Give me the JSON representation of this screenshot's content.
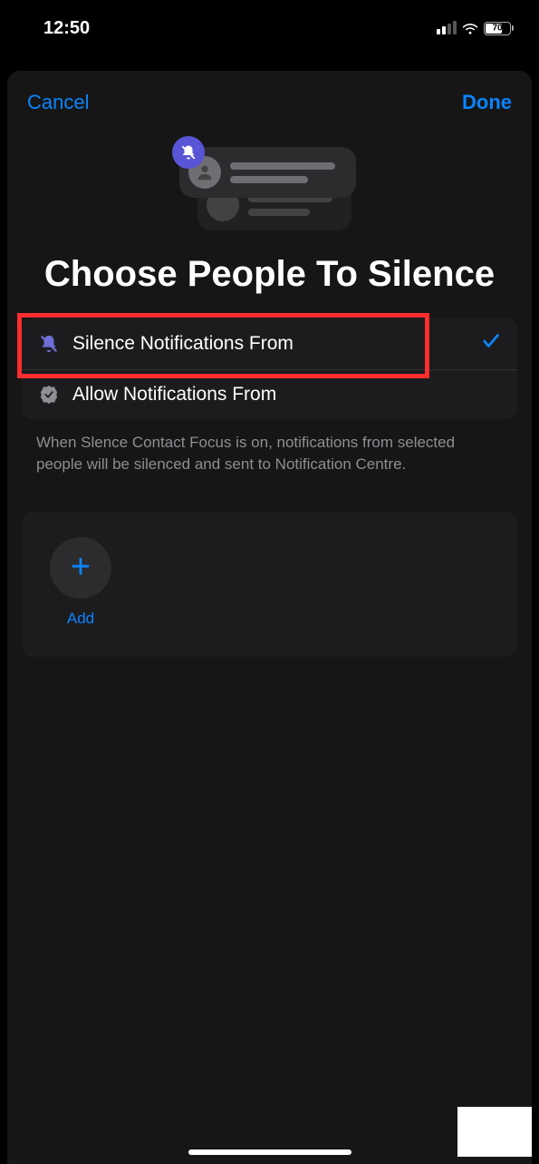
{
  "statusBar": {
    "time": "12:50",
    "batteryPercent": "70"
  },
  "header": {
    "cancel": "Cancel",
    "done": "Done"
  },
  "title": "Choose People To Silence",
  "options": {
    "silence": {
      "label": "Silence Notifications From",
      "selected": true
    },
    "allow": {
      "label": "Allow Notifications From",
      "selected": false
    }
  },
  "footerText": "When Slence Contact Focus is on, notifications from selected people will be silenced and sent to Notification Centre.",
  "addButton": {
    "label": "Add"
  }
}
